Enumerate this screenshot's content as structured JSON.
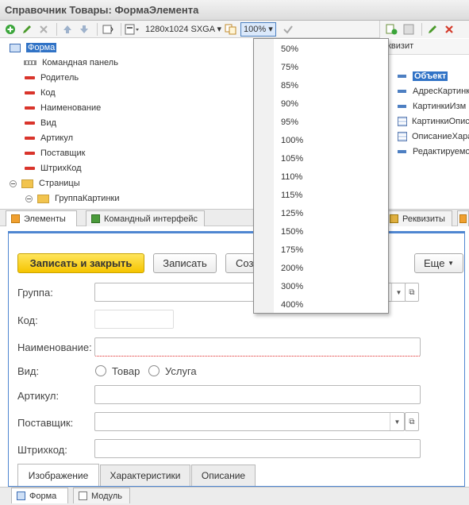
{
  "window": {
    "title": "Справочник Товары: ФормаЭлемента"
  },
  "toolbar": {
    "resolution": "1280x1024 SXGA",
    "zoom": "100%"
  },
  "tree": {
    "root": "Форма",
    "items": [
      "Командная панель",
      "Родитель",
      "Код",
      "Наименование",
      "Вид",
      "Артикул",
      "Поставщик",
      "ШтрихКод",
      "Страницы",
      "ГруппаКартинки"
    ]
  },
  "rightpanel": {
    "header": "еквизит",
    "items": [
      "Объект",
      "АдресКартинк",
      "КартинкиИзм",
      "КартинкиОпис",
      "ОписаниеХара",
      "Редактируемо"
    ]
  },
  "bottom_tabs": {
    "elements": "Элементы",
    "command": "Командный интерфейс",
    "requisites": "Реквизиты"
  },
  "zoom_menu": {
    "options": [
      "50%",
      "75%",
      "85%",
      "90%",
      "95%",
      "100%",
      "105%",
      "110%",
      "115%",
      "125%",
      "150%",
      "175%",
      "200%",
      "300%",
      "400%"
    ]
  },
  "form": {
    "save_close": "Записать и закрыть",
    "save": "Записать",
    "create": "Соз",
    "more": "Еще",
    "fields": {
      "group": "Группа:",
      "code": "Код:",
      "name": "Наименование:",
      "kind": "Вид:",
      "article": "Артикул:",
      "supplier": "Поставщик:",
      "barcode": "Штрихкод:"
    },
    "kind_options": [
      "Товар",
      "Услуга"
    ],
    "tabs": [
      "Изображение",
      "Характеристики",
      "Описание"
    ]
  },
  "footer": {
    "form": "Форма",
    "module": "Модуль"
  }
}
